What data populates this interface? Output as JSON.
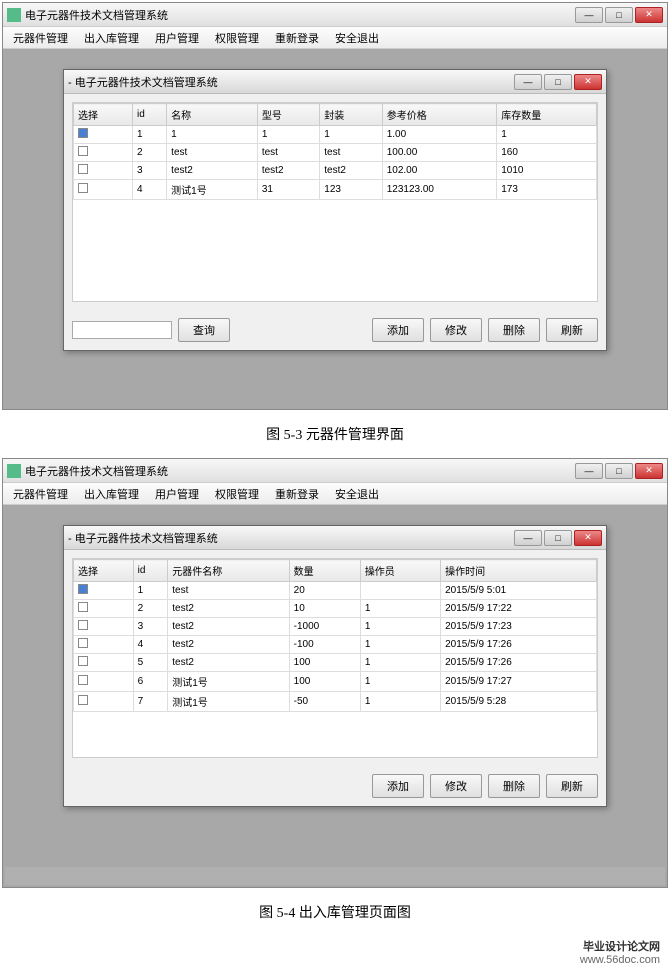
{
  "window1": {
    "title": "电子元器件技术文档管理系统",
    "inner_title": "- 电子元器件技术文档管理系统",
    "menus": [
      "元器件管理",
      "出入库管理",
      "用户管理",
      "权限管理",
      "重新登录",
      "安全退出"
    ],
    "headers": [
      "选择",
      "id",
      "名称",
      "型号",
      "封装",
      "参考价格",
      "库存数量"
    ],
    "rows": [
      {
        "sel": true,
        "id": "1",
        "name": "1",
        "model": "1",
        "pack": "1",
        "price": "1.00",
        "qty": "1"
      },
      {
        "sel": false,
        "id": "2",
        "name": "test",
        "model": "test",
        "pack": "test",
        "price": "100.00",
        "qty": "160"
      },
      {
        "sel": false,
        "id": "3",
        "name": "test2",
        "model": "test2",
        "pack": "test2",
        "price": "102.00",
        "qty": "1010"
      },
      {
        "sel": false,
        "id": "4",
        "name": "测试1号",
        "model": "31",
        "pack": "123",
        "price": "123123.00",
        "qty": "173"
      }
    ],
    "buttons": {
      "query": "查询",
      "add": "添加",
      "edit": "修改",
      "del": "删除",
      "refresh": "刷新"
    }
  },
  "caption1": "图 5-3 元器件管理界面",
  "window2": {
    "title": "电子元器件技术文档管理系统",
    "inner_title": "- 电子元器件技术文档管理系统",
    "menus": [
      "元器件管理",
      "出入库管理",
      "用户管理",
      "权限管理",
      "重新登录",
      "安全退出"
    ],
    "headers": [
      "选择",
      "id",
      "元器件名称",
      "数量",
      "操作员",
      "操作时间"
    ],
    "rows": [
      {
        "sel": true,
        "id": "1",
        "name": "test",
        "qty": "20",
        "op": "",
        "time": "2015/5/9 5:01"
      },
      {
        "sel": false,
        "id": "2",
        "name": "test2",
        "qty": "10",
        "op": "1",
        "time": "2015/5/9 17:22"
      },
      {
        "sel": false,
        "id": "3",
        "name": "test2",
        "qty": "-1000",
        "op": "1",
        "time": "2015/5/9 17:23"
      },
      {
        "sel": false,
        "id": "4",
        "name": "test2",
        "qty": "-100",
        "op": "1",
        "time": "2015/5/9 17:26"
      },
      {
        "sel": false,
        "id": "5",
        "name": "test2",
        "qty": "100",
        "op": "1",
        "time": "2015/5/9 17:26"
      },
      {
        "sel": false,
        "id": "6",
        "name": "测试1号",
        "qty": "100",
        "op": "1",
        "time": "2015/5/9 17:27"
      },
      {
        "sel": false,
        "id": "7",
        "name": "测试1号",
        "qty": "-50",
        "op": "1",
        "time": "2015/5/9 5:28"
      }
    ],
    "buttons": {
      "add": "添加",
      "edit": "修改",
      "del": "删除",
      "refresh": "刷新"
    }
  },
  "caption2": "图 5-4 出入库管理页面图",
  "footer": {
    "brand": "毕业设计论文网",
    "url": "www.56doc.com"
  }
}
